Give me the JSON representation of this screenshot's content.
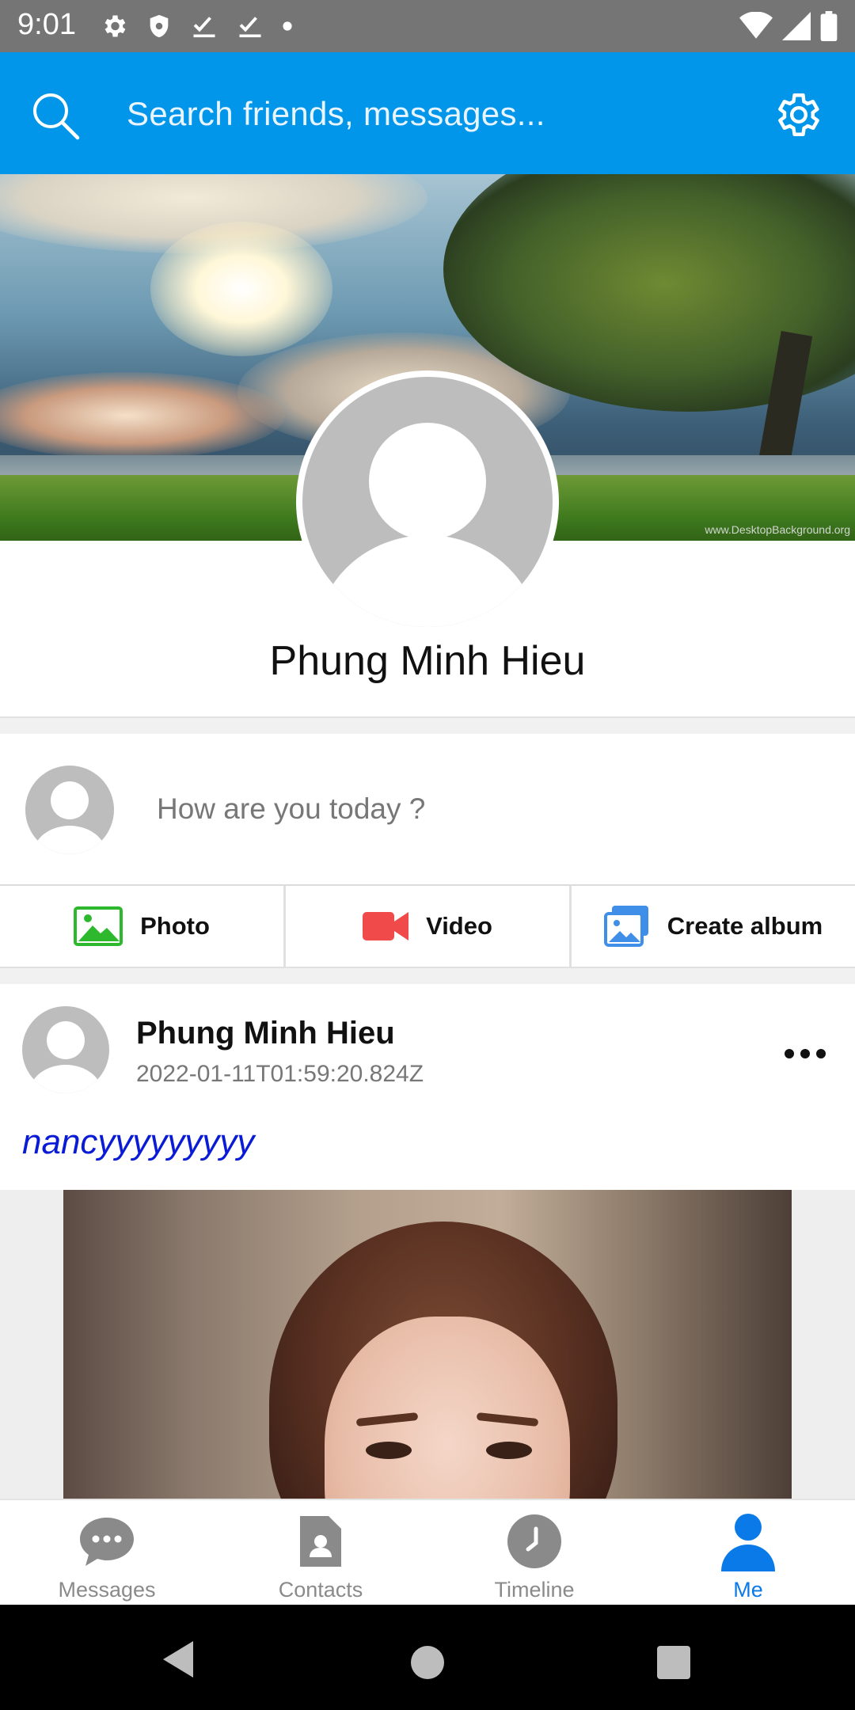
{
  "status_bar": {
    "time": "9:01",
    "icons": [
      "gear-icon",
      "shield-icon",
      "check-icon",
      "check-icon",
      "dot-icon"
    ],
    "right_icons": [
      "wifi-icon",
      "signal-icon",
      "battery-icon"
    ]
  },
  "header": {
    "search_placeholder": "Search friends, messages...",
    "accent_color": "#0296ea"
  },
  "cover": {
    "watermark": "www.DesktopBackground.org"
  },
  "profile": {
    "name": "Phung Minh Hieu"
  },
  "composer": {
    "prompt": "How are you today ?",
    "actions": [
      {
        "label": "Photo",
        "icon": "photo-icon",
        "color": "#2eb82e"
      },
      {
        "label": "Video",
        "icon": "video-icon",
        "color": "#f04a4a"
      },
      {
        "label": "Create album",
        "icon": "album-icon",
        "color": "#3f8fe8"
      }
    ]
  },
  "post": {
    "author": "Phung Minh Hieu",
    "timestamp": "2022-01-11T01:59:20.824Z",
    "caption": "nancyyyyyyyyy",
    "caption_color": "#0a1bd6"
  },
  "bottom_nav": {
    "items": [
      {
        "label": "Messages",
        "icon": "chat-bubble-icon",
        "active": false
      },
      {
        "label": "Contacts",
        "icon": "contact-card-icon",
        "active": false
      },
      {
        "label": "Timeline",
        "icon": "clock-icon",
        "active": false
      },
      {
        "label": "Me",
        "icon": "person-icon",
        "active": true
      }
    ],
    "active_color": "#0a7ae8"
  }
}
